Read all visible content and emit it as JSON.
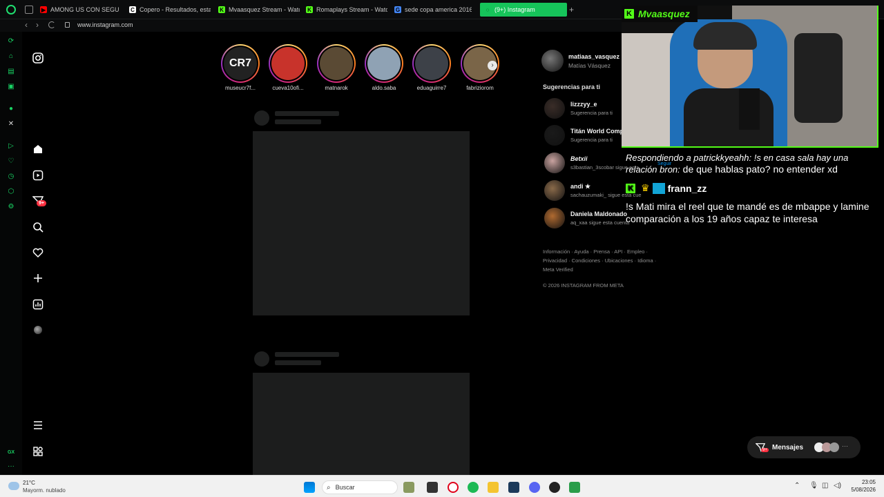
{
  "browser": {
    "tabs": [
      {
        "label": "AMONG US CON SEGU",
        "fav_color": "#ff0000",
        "fav": "▶"
      },
      {
        "label": "Copero - Resultados, esta",
        "fav_color": "#ffffff",
        "fav": "C"
      },
      {
        "label": "Mvaasquez Stream - Watc",
        "fav_color": "#53fc18",
        "fav": "K"
      },
      {
        "label": "Romaplays Stream - Watch",
        "fav_color": "#53fc18",
        "fav": "K"
      },
      {
        "label": "sede copa america 2016 -",
        "fav_color": "#4285f4",
        "fav": "G"
      },
      {
        "label": "(9+) Instagram",
        "fav_color": "#16c45a",
        "fav": "◌"
      }
    ],
    "new_tab": "+",
    "url": "www.instagram.com"
  },
  "stories": [
    {
      "name": "museucr7f...",
      "color": "#222222"
    },
    {
      "name": "cueva10ofi...",
      "color": "#c8332b"
    },
    {
      "name": "matnarok",
      "color": "#5a4a34"
    },
    {
      "name": "aldo.saba",
      "color": "#8fa2b4"
    },
    {
      "name": "eduaguirre7",
      "color": "#3d4148"
    },
    {
      "name": "fabriziorom",
      "color": "#7a6548"
    }
  ],
  "story_cr7_text": "CR7",
  "nav_badge": "9+",
  "profile": {
    "username": "matiaas_vasquez",
    "full_name": "Matías Vásquez"
  },
  "suggestions_title": "Sugerencias para ti",
  "suggestions": [
    {
      "name": "lizzzyy_e",
      "sub": "Sugerencia para ti",
      "color": "#3a2d28"
    },
    {
      "name": "Titán World Comp",
      "sub": "Sugerencia para ti",
      "color": "#1a1a1a"
    },
    {
      "name": "Betxii",
      "sub": "s3bastian_3scobar sigue esta",
      "color": "#c9a3a0"
    },
    {
      "name": "andi ★",
      "sub": "sachauzumaki_ sigue esta cue",
      "color": "#8a6a4a"
    },
    {
      "name": "Daniela Maldonado",
      "sub": "aq_xaa sigue esta cuenta",
      "color": "#b06a30"
    }
  ],
  "follow_label": "Seguir",
  "footer": {
    "line1": "Información · Ayuda · Prensa · API · Empleo ·",
    "line2": "Privacidad · Condiciones · Ubicaciones · Idioma ·",
    "line3": "Meta Verified",
    "copyright": "© 2026 INSTAGRAM FROM META"
  },
  "stream": {
    "streamer": "Mvaasquez",
    "chat1_prefix": "Respondiendo a patrickkyeahh: !s en casa sala hay una relación bron:",
    "chat1_text": "de que hablas pato? no entender xd",
    "chat2_user": "frann_zz",
    "chat2_text": "!s Mati mira el reel que te mandé es de mbappe y lamine comparación a los 19 años capaz te interesa"
  },
  "messages": {
    "label": "Mensajes",
    "badge": "9+"
  },
  "taskbar": {
    "weather_temp": "21°C",
    "weather_desc": "Mayorm. nublado",
    "search_placeholder": "Buscar",
    "time": "23:05",
    "date": "5/08/2026"
  },
  "colors": {
    "opera_green": "#19d364",
    "kick_green": "#53fc18",
    "badge_red": "#ff3040"
  }
}
